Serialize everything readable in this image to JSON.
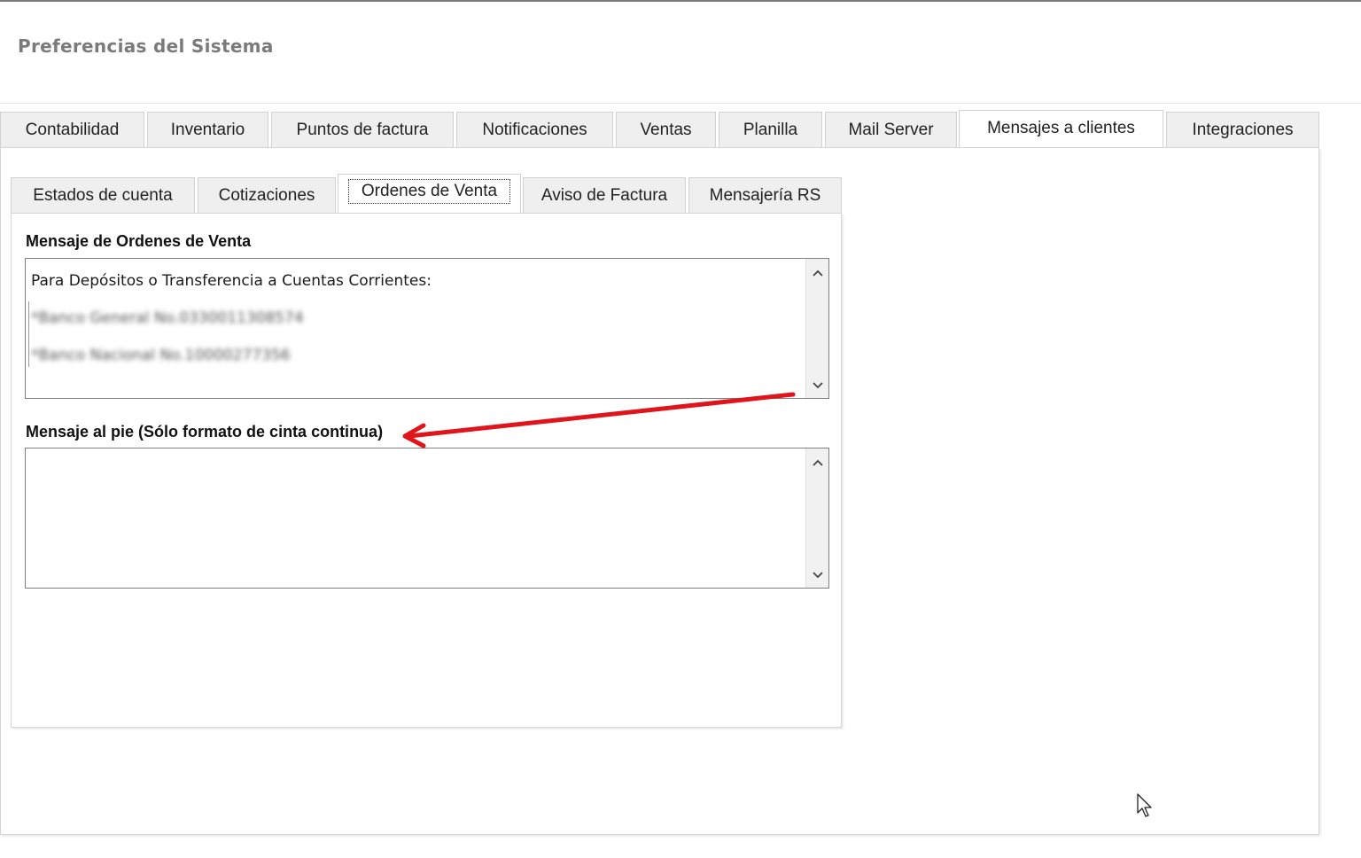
{
  "header": {
    "title": "Preferencias del Sistema"
  },
  "main_tabs": [
    {
      "label": "Contabilidad"
    },
    {
      "label": "Inventario"
    },
    {
      "label": "Puntos de factura"
    },
    {
      "label": "Notificaciones"
    },
    {
      "label": "Ventas"
    },
    {
      "label": "Planilla"
    },
    {
      "label": "Mail Server"
    },
    {
      "label": "Mensajes a clientes",
      "active": true
    },
    {
      "label": "Integraciones"
    }
  ],
  "sub_tabs": [
    {
      "label": "Estados de cuenta"
    },
    {
      "label": "Cotizaciones"
    },
    {
      "label": "Ordenes de Venta",
      "active": true
    },
    {
      "label": "Aviso de Factura"
    },
    {
      "label": "Mensajería RS"
    }
  ],
  "form": {
    "order_message": {
      "label": "Mensaje de Ordenes de Venta",
      "lines": [
        "Para Depósitos o Transferencia a Cuentas Corrientes:",
        "*Banco General No.0330011308574",
        "*Banco Nacional No.10000277356"
      ]
    },
    "footer_message": {
      "label": "Mensaje al pie (Sólo formato de cinta continua)",
      "value": ""
    }
  },
  "colors": {
    "annotation_arrow": "#e0141b",
    "title_gray": "#7b7b7b",
    "tab_background": "#efefef"
  },
  "icons": {
    "scroll_up": "chevron-up-icon",
    "scroll_down": "chevron-down-icon",
    "mouse_cursor": "mouse-pointer-icon"
  }
}
